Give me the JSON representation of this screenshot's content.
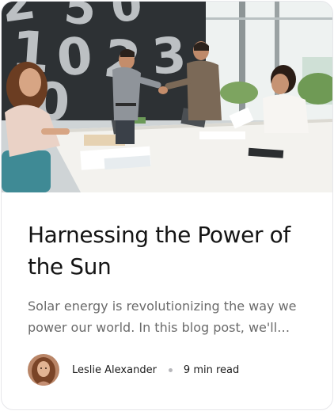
{
  "card": {
    "title": "Harnessing the Power of the Sun",
    "excerpt": "Solar energy is revolutionizing the way we power our world. In this blog post, we'll delve into how solar panels work and why they matter.",
    "image": {
      "wall_digits": [
        "2",
        "5",
        "0",
        "1",
        "0",
        "2",
        "3",
        "0"
      ]
    },
    "author": {
      "name": "Leslie Alexander",
      "read_time": "9 min read"
    }
  },
  "colors": {
    "title": "#141414",
    "excerpt": "#6b6b6b",
    "meta_text": "#1c1c1c",
    "separator_dot": "#b7b7bb",
    "card_border": "#e6e6ea"
  }
}
